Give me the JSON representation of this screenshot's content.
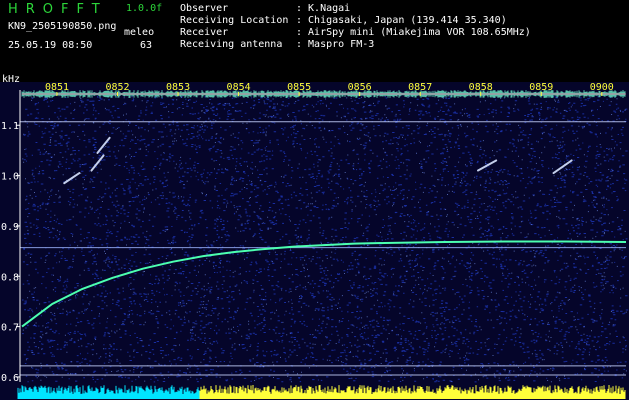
{
  "header": {
    "brand": "HROFFT",
    "version": "1.0.0f",
    "file_name": "KN9_2505190850.png",
    "timestamp": "25.05.19 08:50",
    "meleo_label": "meleo",
    "meleo_value": "63"
  },
  "meta": {
    "observer_label": "Observer",
    "observer_value": ": K.Nagai",
    "location_label": "Receiving Location",
    "location_value": ": Chigasaki, Japan (139.414 35.340)",
    "receiver_label": "Receiver",
    "receiver_value": ": AirSpy mini (Miakejima VOR 108.65MHz)",
    "antenna_label": "Receiving antenna",
    "antenna_value": ": Maspro FM-3"
  },
  "axis": {
    "unit": "kHz"
  },
  "chart_data": {
    "type": "heatmap",
    "title": "",
    "xlabel": "",
    "ylabel": "kHz",
    "x_ticks": [
      "0851",
      "0852",
      "0853",
      "0854",
      "0855",
      "0856",
      "0857",
      "0858",
      "0859",
      "0900"
    ],
    "y_ticks": [
      0.6,
      0.7,
      0.8,
      0.9,
      1.0,
      1.1
    ],
    "ylim": [
      0.59,
      1.17
    ],
    "xlim": [
      0,
      10
    ],
    "background_color": "#05052a",
    "noise_color": "#2a4fff",
    "trace_color": "#4cffb0",
    "reference_lines_khz": [
      1.107,
      0.857,
      0.622,
      0.604
    ],
    "doppler_trace": {
      "x": [
        0.0,
        0.5,
        1.0,
        1.5,
        2.0,
        2.5,
        3.0,
        3.5,
        4.0,
        4.5,
        5.0,
        5.5,
        6.0,
        6.5,
        7.0,
        8.0,
        9.0,
        10.0
      ],
      "y": [
        0.7,
        0.745,
        0.775,
        0.797,
        0.815,
        0.829,
        0.84,
        0.848,
        0.854,
        0.859,
        0.862,
        0.865,
        0.866,
        0.867,
        0.868,
        0.869,
        0.869,
        0.868
      ]
    },
    "meteor_echoes": [
      {
        "x": [
          1.25,
          1.45
        ],
        "y": [
          1.045,
          1.075
        ]
      },
      {
        "x": [
          1.15,
          1.35
        ],
        "y": [
          1.01,
          1.04
        ]
      },
      {
        "x": [
          0.7,
          0.95
        ],
        "y": [
          0.985,
          1.005
        ]
      },
      {
        "x": [
          7.55,
          7.85
        ],
        "y": [
          1.01,
          1.03
        ]
      },
      {
        "x": [
          8.8,
          9.1
        ],
        "y": [
          1.005,
          1.03
        ]
      }
    ],
    "signal_level_bar": {
      "y_khz": 0.595,
      "color_low": "#00e5ff",
      "color_high": "#ffff3a"
    }
  }
}
